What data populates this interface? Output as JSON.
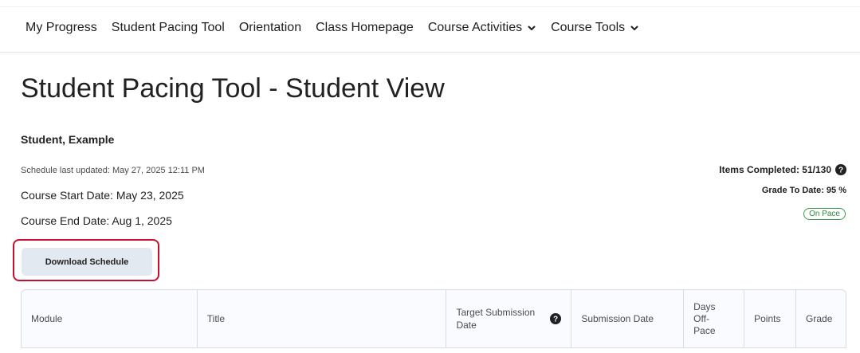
{
  "nav": {
    "items": [
      {
        "label": "My Progress",
        "dropdown": false
      },
      {
        "label": "Student Pacing Tool",
        "dropdown": false
      },
      {
        "label": "Orientation",
        "dropdown": false
      },
      {
        "label": "Class Homepage",
        "dropdown": false
      },
      {
        "label": "Course Activities",
        "dropdown": true
      },
      {
        "label": "Course Tools",
        "dropdown": true
      }
    ]
  },
  "page": {
    "title": "Student Pacing Tool - Student View",
    "student_name": "Student, Example",
    "schedule_updated": "Schedule last updated: May 27, 2025 12:11 PM",
    "course_start": "Course Start Date: May 23, 2025",
    "course_end": "Course End Date: Aug 1, 2025"
  },
  "stats": {
    "items_completed": "Items Completed: 51/130",
    "grade_to_date": "Grade To Date: 95 %",
    "pace_status": "On Pace"
  },
  "actions": {
    "download_label": "Download Schedule"
  },
  "table": {
    "headers": [
      "Module",
      "Title",
      "Target Submission Date",
      "Submission Date",
      "Days Off-Pace",
      "Points",
      "Grade"
    ]
  },
  "colors": {
    "highlight": "#c8102e",
    "on_pace": "#2b8a3e",
    "button_bg": "#e3e9f1"
  },
  "icons": {
    "dropdown": "chevron-down-icon",
    "help": "help-circle-icon"
  }
}
